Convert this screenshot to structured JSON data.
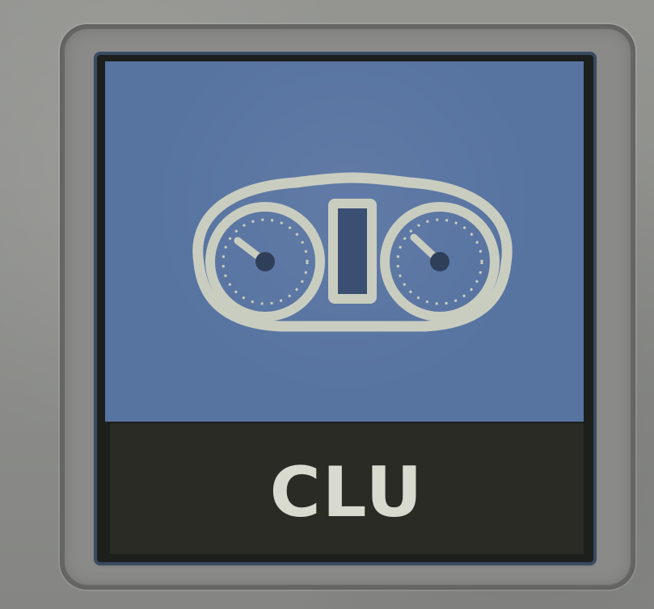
{
  "tile": {
    "label": "CLU",
    "icon": "instrument-cluster-icon",
    "colors": {
      "top": "#5773a0",
      "bottom": "#2a2b25",
      "label": "#d8d9cf",
      "icon": "#c9cdc0"
    }
  }
}
